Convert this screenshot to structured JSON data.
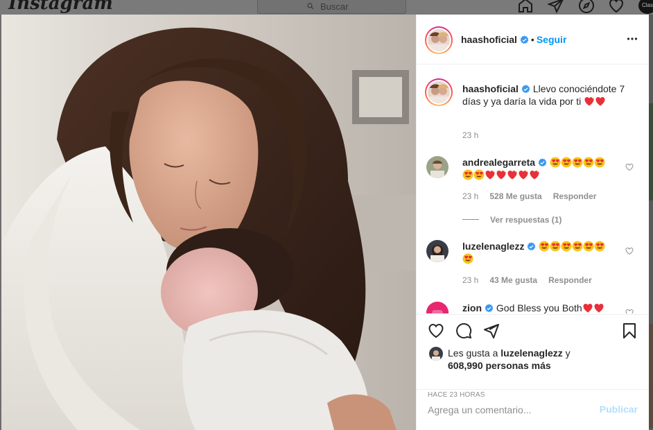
{
  "topbar": {
    "logo": "Instagram",
    "search_placeholder": "Buscar",
    "profile_label": "Clas"
  },
  "post": {
    "author": "haashoficial",
    "follow_label": "Seguir",
    "dot": "•",
    "caption": "Llevo conociéndote 7 días y ya daría la vida por ti",
    "caption_time": "23 h"
  },
  "comments": [
    {
      "user": "andrealegarreta",
      "text_emojis": [
        "heart-eyes",
        "heart-eyes",
        "heart-eyes",
        "heart-eyes",
        "heart-eyes",
        "heart-eyes",
        "heart-eyes",
        "sparkle-heart",
        "sparkle-heart",
        "sparkle-heart",
        "sparkle-heart",
        "sparkle-heart"
      ],
      "time": "23 h",
      "likes": "528 Me gusta",
      "reply": "Responder",
      "view_replies": "Ver respuestas (1)"
    },
    {
      "user": "luzelenaglezz",
      "text_emojis": [
        "heart-eyes",
        "heart-eyes",
        "heart-eyes",
        "heart-eyes",
        "heart-eyes",
        "heart-eyes",
        "heart-eyes"
      ],
      "time": "23 h",
      "likes": "43 Me gusta",
      "reply": "Responder"
    },
    {
      "user": "zion",
      "text": "God Bless you Both"
    }
  ],
  "likes": {
    "prefix": "Les gusta a",
    "user": "luzelenaglezz",
    "conj": "y",
    "count": "608,990 personas más"
  },
  "time_ago": "HACE 23 HORAS",
  "comment_box": {
    "placeholder": "Agrega un comentario...",
    "publish_label": "Publicar"
  },
  "colors": {
    "accent": "#0095f6",
    "publish_disabled": "#b2dffc",
    "verified": "#3897f0",
    "heart": "#ed4956"
  }
}
